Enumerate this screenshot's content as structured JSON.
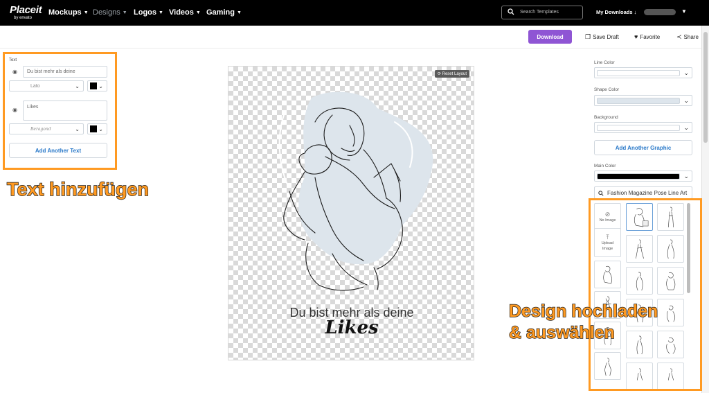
{
  "nav": {
    "logo": "Placeit",
    "logo_sub": "by envato",
    "items": [
      {
        "label": "Mockups",
        "muted": false
      },
      {
        "label": "Designs",
        "muted": true
      },
      {
        "label": "Logos",
        "muted": false
      },
      {
        "label": "Videos",
        "muted": false
      },
      {
        "label": "Gaming",
        "muted": false
      }
    ],
    "search_placeholder": "Search Templates",
    "my_downloads": "My Downloads ↓"
  },
  "toolbar": {
    "download": "Download",
    "save_draft": "Save Draft",
    "favorite": "Favorite",
    "share": "Share"
  },
  "text_panel": {
    "title": "Text",
    "line1_value": "Du bist mehr als deine",
    "line1_font": "Lato",
    "line2_value": "Likes",
    "line2_font": "Beragond",
    "add_text": "Add Another Text"
  },
  "annotations": {
    "left": "Text hinzufügen",
    "right_line1": "Design hochladen",
    "right_line2": "& auswählen"
  },
  "canvas": {
    "reset_layout": "Reset Layout",
    "text_line1": "Du bist mehr als deine",
    "text_line2": "Likes"
  },
  "right_panel": {
    "line_color": "Line Color",
    "shape_color": "Shape Color",
    "background": "Background",
    "add_graphic": "Add Another Graphic",
    "main_color": "Main Color",
    "search_value": "Fashion Magazine Pose Line Art",
    "no_image": "No Image",
    "upload_image": "Upload Image"
  },
  "colors": {
    "accent_purple": "#8f55d4",
    "annotation_orange": "#ff9a22",
    "shape_blue": "#dde5ec",
    "link_blue": "#2a79c9"
  }
}
